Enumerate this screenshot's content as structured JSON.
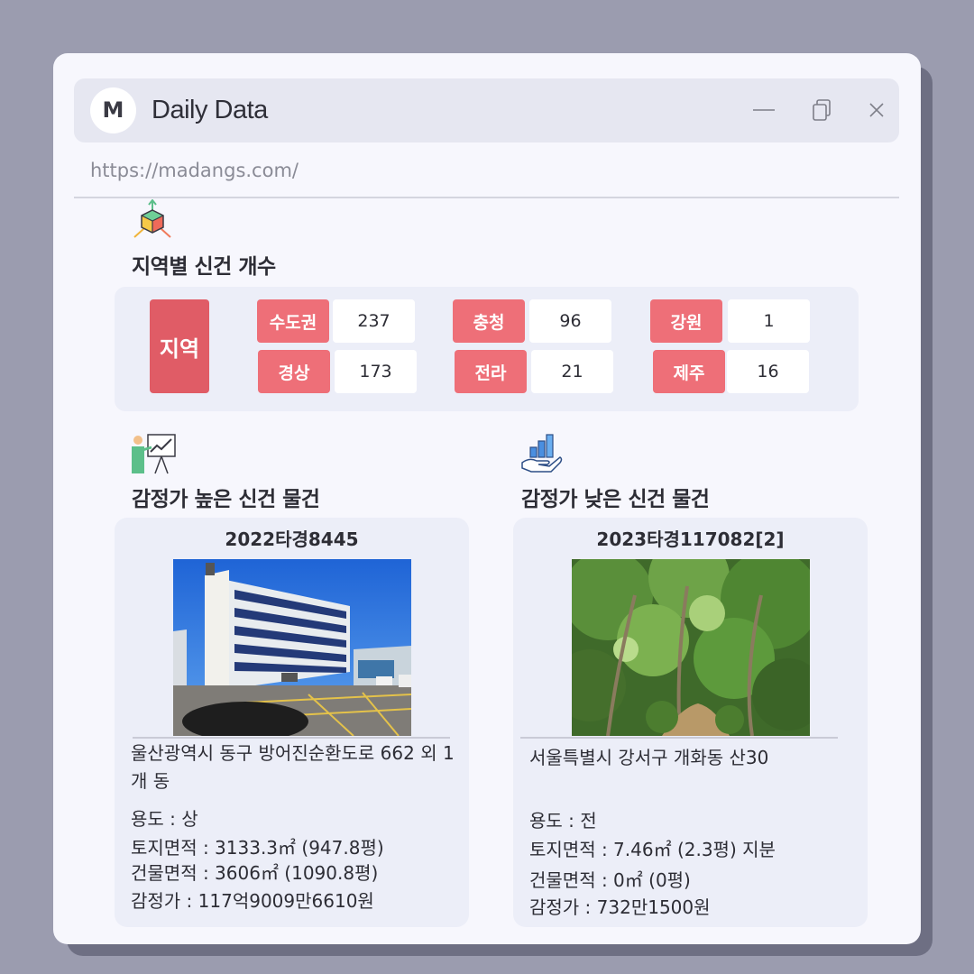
{
  "window": {
    "logo_letter": "M",
    "title": "Daily Data",
    "url": "https://madangs.com/"
  },
  "region_section": {
    "title": "지역별 신건 개수",
    "icon": "cube-axes-icon",
    "header": "지역",
    "regions": [
      {
        "name": "수도권",
        "count": "237"
      },
      {
        "name": "충청",
        "count": "96"
      },
      {
        "name": "강원",
        "count": "1"
      },
      {
        "name": "경상",
        "count": "173"
      },
      {
        "name": "전라",
        "count": "21"
      },
      {
        "name": "제주",
        "count": "16"
      }
    ]
  },
  "high_section": {
    "title": "감정가 높은 신건 물건",
    "icon": "presentation-chart-icon",
    "case_no": "2022타경8445",
    "address": "울산광역시 동구 방어진순환도로 662 외 1개 동",
    "usage": "용도 : 상",
    "land_area": "토지면적 : 3133.3㎡ (947.8평)",
    "building_area": "건물면적 : 3606㎡ (1090.8평)",
    "appraisal": "감정가 : 117억9009만6610원"
  },
  "low_section": {
    "title": "감정가 낮은 신건 물건",
    "icon": "hand-bar-chart-icon",
    "case_no": "2023타경117082[2]",
    "address": "서울특별시 강서구 개화동 산30",
    "usage": "용도 : 전",
    "land_area": "토지면적 : 7.46㎡ (2.3평) 지분",
    "building_area": "건물면적 : 0㎡ (0평)",
    "appraisal": "감정가 : 732만1500원"
  },
  "colors": {
    "accent_header": "#e05c66",
    "accent_label": "#ee6f78",
    "background": "#9b9caf",
    "panel": "#eceef8"
  }
}
